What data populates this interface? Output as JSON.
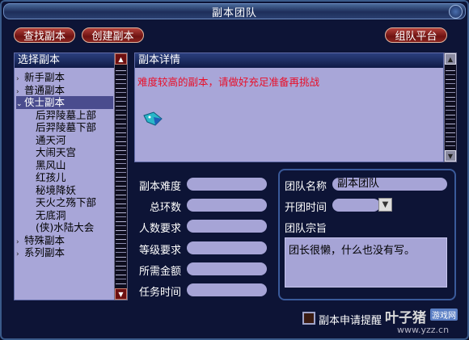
{
  "window": {
    "title": "副本团队"
  },
  "toolbar": {
    "find_label": "查找副本",
    "create_label": "创建副本",
    "platform_label": "组队平台"
  },
  "left_panel": {
    "header": "选择副本",
    "items": [
      {
        "label": "新手副本",
        "level": 0,
        "expanded": false,
        "selected": false
      },
      {
        "label": "普通副本",
        "level": 0,
        "expanded": false,
        "selected": false
      },
      {
        "label": "侠士副本",
        "level": 0,
        "expanded": true,
        "selected": true
      },
      {
        "label": "后羿陵墓上部",
        "level": 1,
        "selected": false
      },
      {
        "label": "后羿陵墓下部",
        "level": 1,
        "selected": false
      },
      {
        "label": "通天河",
        "level": 1,
        "selected": false
      },
      {
        "label": "大闹天宫",
        "level": 1,
        "selected": false
      },
      {
        "label": "黑风山",
        "level": 1,
        "selected": false
      },
      {
        "label": "红孩儿",
        "level": 1,
        "selected": false
      },
      {
        "label": "秘境降妖",
        "level": 1,
        "selected": false
      },
      {
        "label": "天火之殇下部",
        "level": 1,
        "selected": false
      },
      {
        "label": "无底洞",
        "level": 1,
        "selected": false
      },
      {
        "label": "(侠)水陆大会",
        "level": 1,
        "selected": false
      },
      {
        "label": "特殊副本",
        "level": 0,
        "expanded": false,
        "selected": false
      },
      {
        "label": "系列副本",
        "level": 0,
        "expanded": false,
        "selected": false
      }
    ]
  },
  "detail": {
    "header": "副本详情",
    "text": "难度较高的副本，请做好充足准备再挑战",
    "text_color": "#e8102a"
  },
  "fields": [
    {
      "label": "副本难度",
      "value": ""
    },
    {
      "label": "总环数",
      "value": ""
    },
    {
      "label": "人数要求",
      "value": ""
    },
    {
      "label": "等级要求",
      "value": ""
    },
    {
      "label": "所需金额",
      "value": ""
    },
    {
      "label": "任务时间",
      "value": ""
    }
  ],
  "group": {
    "name_label": "团队名称",
    "name_value": "副本团队",
    "time_label": "开团时间",
    "time_value": "",
    "motto_label": "团队宗旨",
    "motto_value": "团长很懒，什么也没有写。"
  },
  "checkbox": {
    "label": "副本申请提醒",
    "checked": false
  },
  "watermark": {
    "brand": "叶子猪",
    "badge": "游戏网",
    "url": "www.yzz.cn"
  }
}
